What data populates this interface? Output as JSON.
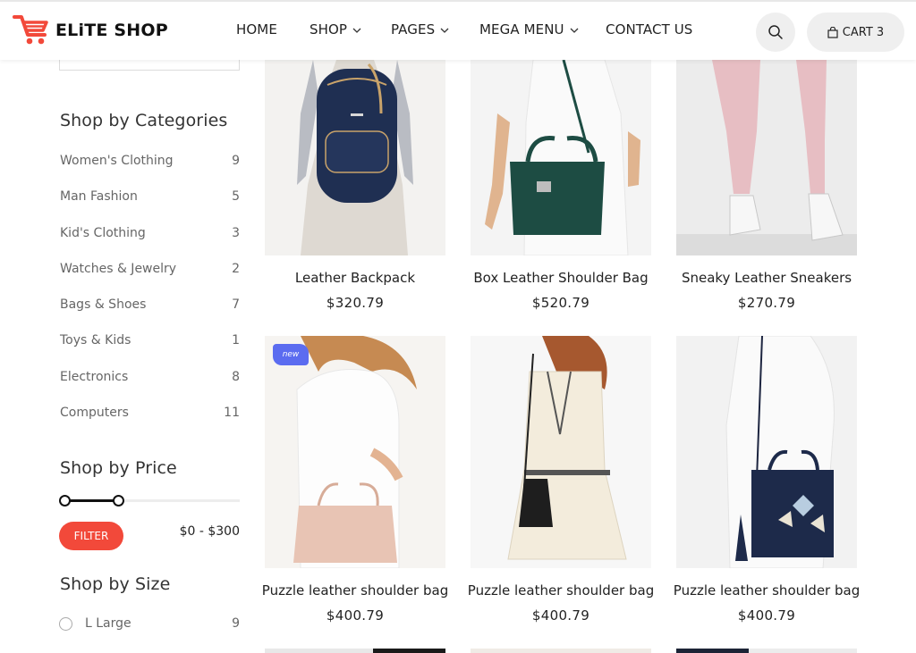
{
  "brand": {
    "name": "ELiTE SHOP",
    "accent": "#f2493a"
  },
  "nav": {
    "items": [
      {
        "label": "HOME",
        "dropdown": false
      },
      {
        "label": "SHOP",
        "dropdown": true
      },
      {
        "label": "PAGES",
        "dropdown": true
      },
      {
        "label": "MEGA MENU",
        "dropdown": true
      },
      {
        "label": "CONTACT US",
        "dropdown": false
      }
    ],
    "search_icon": "search-icon",
    "cart_label": "CART 3",
    "cart_icon": "shopping-bag-icon"
  },
  "sidebar": {
    "categories_title": "Shop by Categories",
    "categories": [
      {
        "label": "Women's Clothing",
        "count": "9"
      },
      {
        "label": "Man Fashion",
        "count": "5"
      },
      {
        "label": "Kid's Clothing",
        "count": "3"
      },
      {
        "label": "Watches & Jewelry",
        "count": "2"
      },
      {
        "label": "Bags & Shoes",
        "count": "7"
      },
      {
        "label": "Toys & Kids",
        "count": "1"
      },
      {
        "label": "Electronics",
        "count": "8"
      },
      {
        "label": "Computers",
        "count": "11"
      }
    ],
    "price_title": "Shop by Price",
    "filter_label": "FILTER",
    "price_range": "$0 - $300",
    "size_title": "Shop by Size",
    "sizes": [
      {
        "label": "L Large",
        "count": "9"
      }
    ]
  },
  "products": [
    {
      "name": "Leather Backpack",
      "price": "$320.79",
      "badge": ""
    },
    {
      "name": "Box Leather Shoulder Bag",
      "price": "$520.79",
      "badge": ""
    },
    {
      "name": "Sneaky Leather Sneakers",
      "price": "$270.79",
      "badge": ""
    },
    {
      "name": "Puzzle leather shoulder bag",
      "price": "$400.79",
      "badge": "new"
    },
    {
      "name": "Puzzle leather shoulder bag",
      "price": "$400.79",
      "badge": ""
    },
    {
      "name": "Puzzle leather shoulder bag",
      "price": "$400.79",
      "badge": ""
    }
  ]
}
